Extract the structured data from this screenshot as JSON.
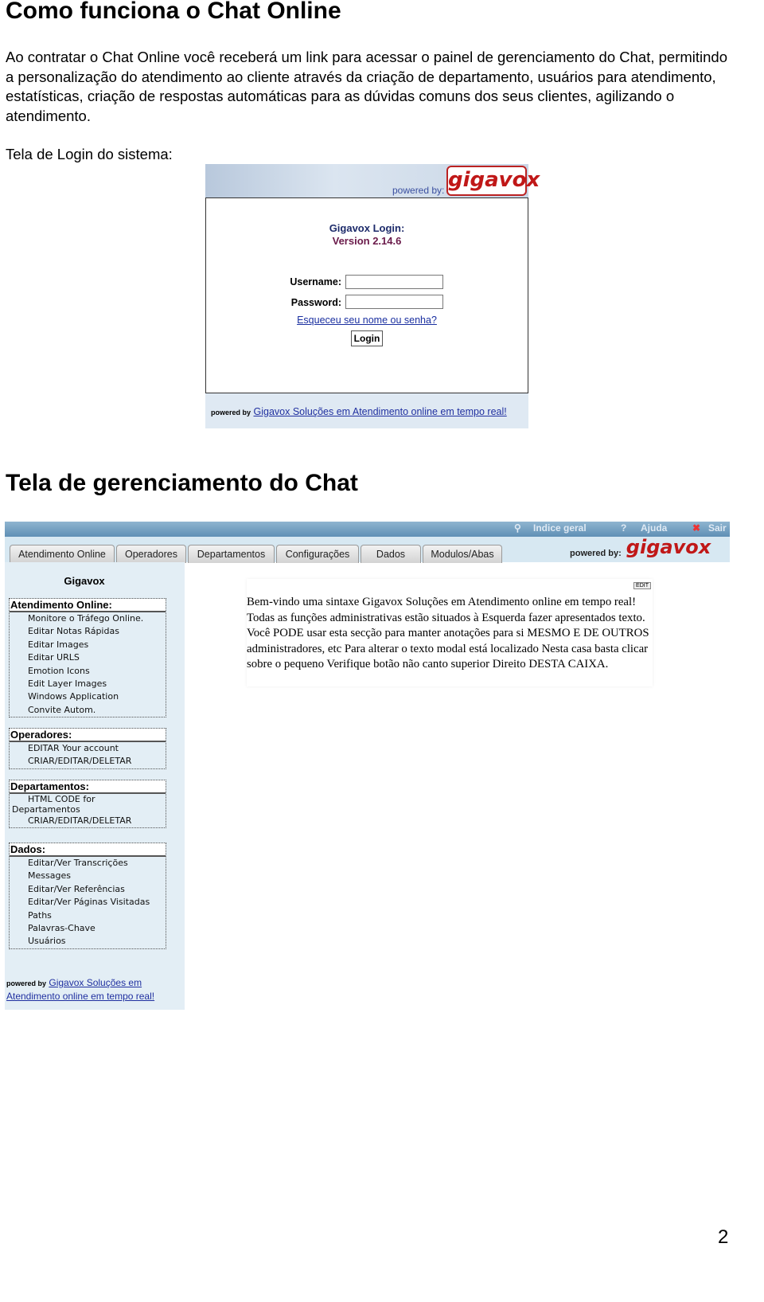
{
  "heading1": "Como funciona o Chat Online",
  "paragraph": "Ao contratar o Chat Online você receberá um link para acessar o painel de gerenciamento do Chat, permitindo a personalização do atendimento ao cliente através da criação de departamento, usuários para atendimento, estatísticas, criação de respostas automáticas para as dúvidas comuns dos seus clientes, agilizando o atendimento.",
  "login_caption": "Tela de Login do sistema:",
  "login": {
    "powered_by": "powered by:",
    "logo": "gigavox",
    "title": "Gigavox Login:",
    "version": "Version 2.14.6",
    "username_label": "Username:",
    "username_value": "",
    "password_label": "Password:",
    "password_value": "",
    "forgot_link": "Esqueceu seu nome ou senha?",
    "login_button": "Login",
    "footer_small": "powered by",
    "footer_link": "Gigavox Soluções em Atendimento online em tempo real!"
  },
  "heading2": "Tela de gerenciamento do Chat",
  "mgmt": {
    "top_links": [
      "Indice geral",
      "Ajuda",
      "Sair"
    ],
    "tabs": [
      "Atendimento Online",
      "Operadores",
      "Departamentos",
      "Configurações",
      "Dados",
      "Modulos/Abas"
    ],
    "powered_by": "powered by:",
    "logo": "gigavox",
    "sidebar_title": "Gigavox",
    "sections": [
      {
        "title": "Atendimento Online:",
        "items": [
          "Monitore o Tráfego Online.",
          "Editar Notas Rápidas",
          "Editar Images",
          "Editar URLS",
          "Emotion Icons",
          "Edit Layer Images",
          "Windows Application",
          "Convite Autom."
        ]
      },
      {
        "title": "Operadores:",
        "items": [
          "EDITAR Your account",
          "CRIAR/EDITAR/DELETAR"
        ]
      },
      {
        "title": "Departamentos:",
        "items": [
          "HTML CODE for",
          "Departamentos",
          "CRIAR/EDITAR/DELETAR"
        ]
      },
      {
        "title": "Dados:",
        "items": [
          "Editar/Ver Transcrições",
          "Messages",
          "Editar/Ver Referências",
          "Editar/Ver Páginas Visitadas",
          "Paths",
          "Palavras-Chave",
          "Usuários"
        ]
      }
    ],
    "footer_small": "powered by",
    "footer_link": "Gigavox Soluções em Atendimento online em tempo real!",
    "edit_button": "EDIT",
    "welcome_text": "Bem-vindo uma sintaxe Gigavox Soluções em Atendimento online em tempo real! Todas as funções administrativas estão situados à Esquerda fazer apresentados texto. Você PODE usar esta secção para manter anotações para si MESMO E DE OUTROS administradores, etc Para alterar o texto modal está localizado Nesta casa basta clicar sobre o pequeno Verifique botão não canto superior Direito DESTA CAIXA."
  },
  "page_number": "2"
}
